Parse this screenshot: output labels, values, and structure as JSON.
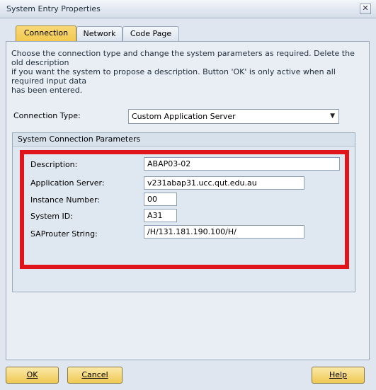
{
  "window": {
    "title": "System Entry Properties"
  },
  "tabs": [
    {
      "label": "Connection",
      "active": true
    },
    {
      "label": "Network",
      "active": false
    },
    {
      "label": "Code Page",
      "active": false
    }
  ],
  "instructions": {
    "line1": "Choose the connection type and change the system parameters as required. Delete the old description",
    "line2": "if you want the system to propose a description. Button 'OK' is only active when all required input data",
    "line3": "has been entered."
  },
  "connection_type": {
    "label": "Connection Type:",
    "value": "Custom Application Server"
  },
  "group": {
    "title": "System Connection Parameters",
    "fields": [
      {
        "label": "Description:",
        "value": "ABAP03-02"
      },
      {
        "label": "Application Server:",
        "value": "v231abap31.ucc.qut.edu.au"
      },
      {
        "label": "Instance Number:",
        "value": "00"
      },
      {
        "label": "System ID:",
        "value": "A31"
      },
      {
        "label": "SAProuter String:",
        "value": "/H/131.181.190.100/H/"
      }
    ]
  },
  "buttons": {
    "ok": "OK",
    "cancel": "Cancel",
    "help": "Help"
  },
  "colors": {
    "highlight": "#e0141b",
    "active_tab": "#f3c94f",
    "button": "#f0c954"
  }
}
